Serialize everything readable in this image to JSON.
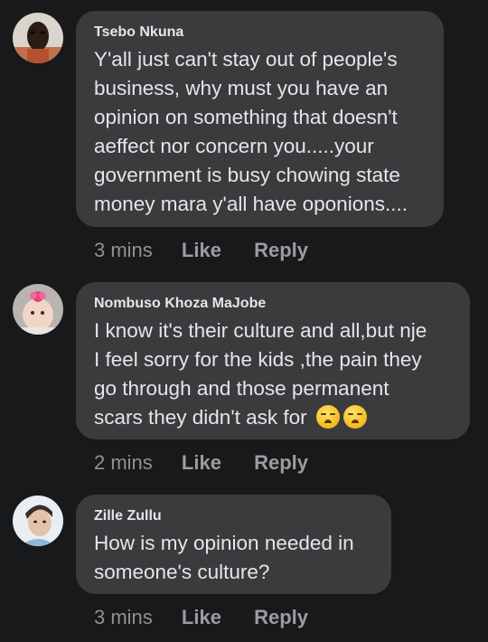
{
  "comments": [
    {
      "author": "Tsebo Nkuna",
      "lines": [
        "Y'all just can't stay out of people's",
        "business, why must you have an",
        "opinion on something that doesn't",
        "aeffect nor concern you.....your",
        "government is busy chowing state",
        "money mara y'all have oponions...."
      ],
      "time": "3 mins",
      "like_label": "Like",
      "reply_label": "Reply",
      "avatar": "person-avatar"
    },
    {
      "author": "Nombuso Khoza MaJobe",
      "lines": [
        "I know it's their culture and all,but nje",
        "I feel sorry for the kids ,the pain they",
        "go through and those permanent",
        "scars they didn't ask for"
      ],
      "emojis": [
        "crying-face-emoji",
        "crying-face-emoji"
      ],
      "time": "2 mins",
      "like_label": "Like",
      "reply_label": "Reply",
      "avatar": "baby-avatar"
    },
    {
      "author": "Zille Zullu",
      "lines": [
        "How is my opinion needed in",
        "someone's culture?"
      ],
      "time": "3 mins",
      "like_label": "Like",
      "reply_label": "Reply",
      "avatar": "woman-avatar"
    }
  ],
  "colors": {
    "background": "#18191a",
    "bubble": "#3a3b3c",
    "text": "#e4e6eb",
    "meta": "#8f9194"
  }
}
